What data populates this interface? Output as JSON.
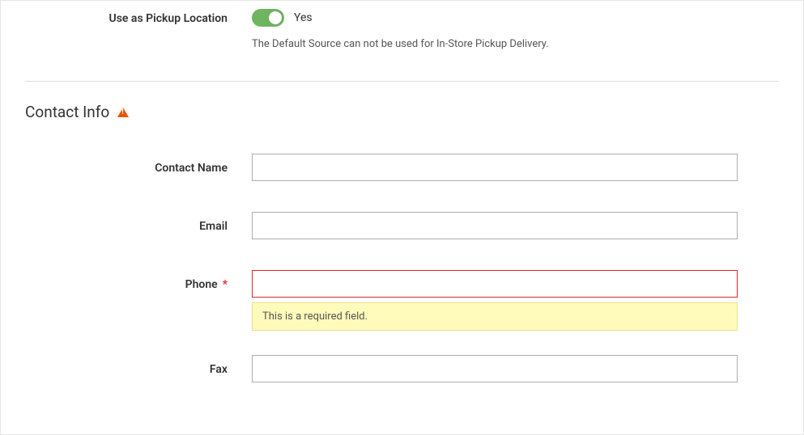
{
  "pickup": {
    "label": "Use as Pickup Location",
    "state_text": "Yes",
    "help_text": "The Default Source can not be used for In-Store Pickup Delivery."
  },
  "section": {
    "title": "Contact Info"
  },
  "fields": {
    "contact_name": {
      "label": "Contact Name",
      "value": ""
    },
    "email": {
      "label": "Email",
      "value": ""
    },
    "phone": {
      "label": "Phone",
      "value": "",
      "error": "This is a required field."
    },
    "fax": {
      "label": "Fax",
      "value": ""
    }
  }
}
